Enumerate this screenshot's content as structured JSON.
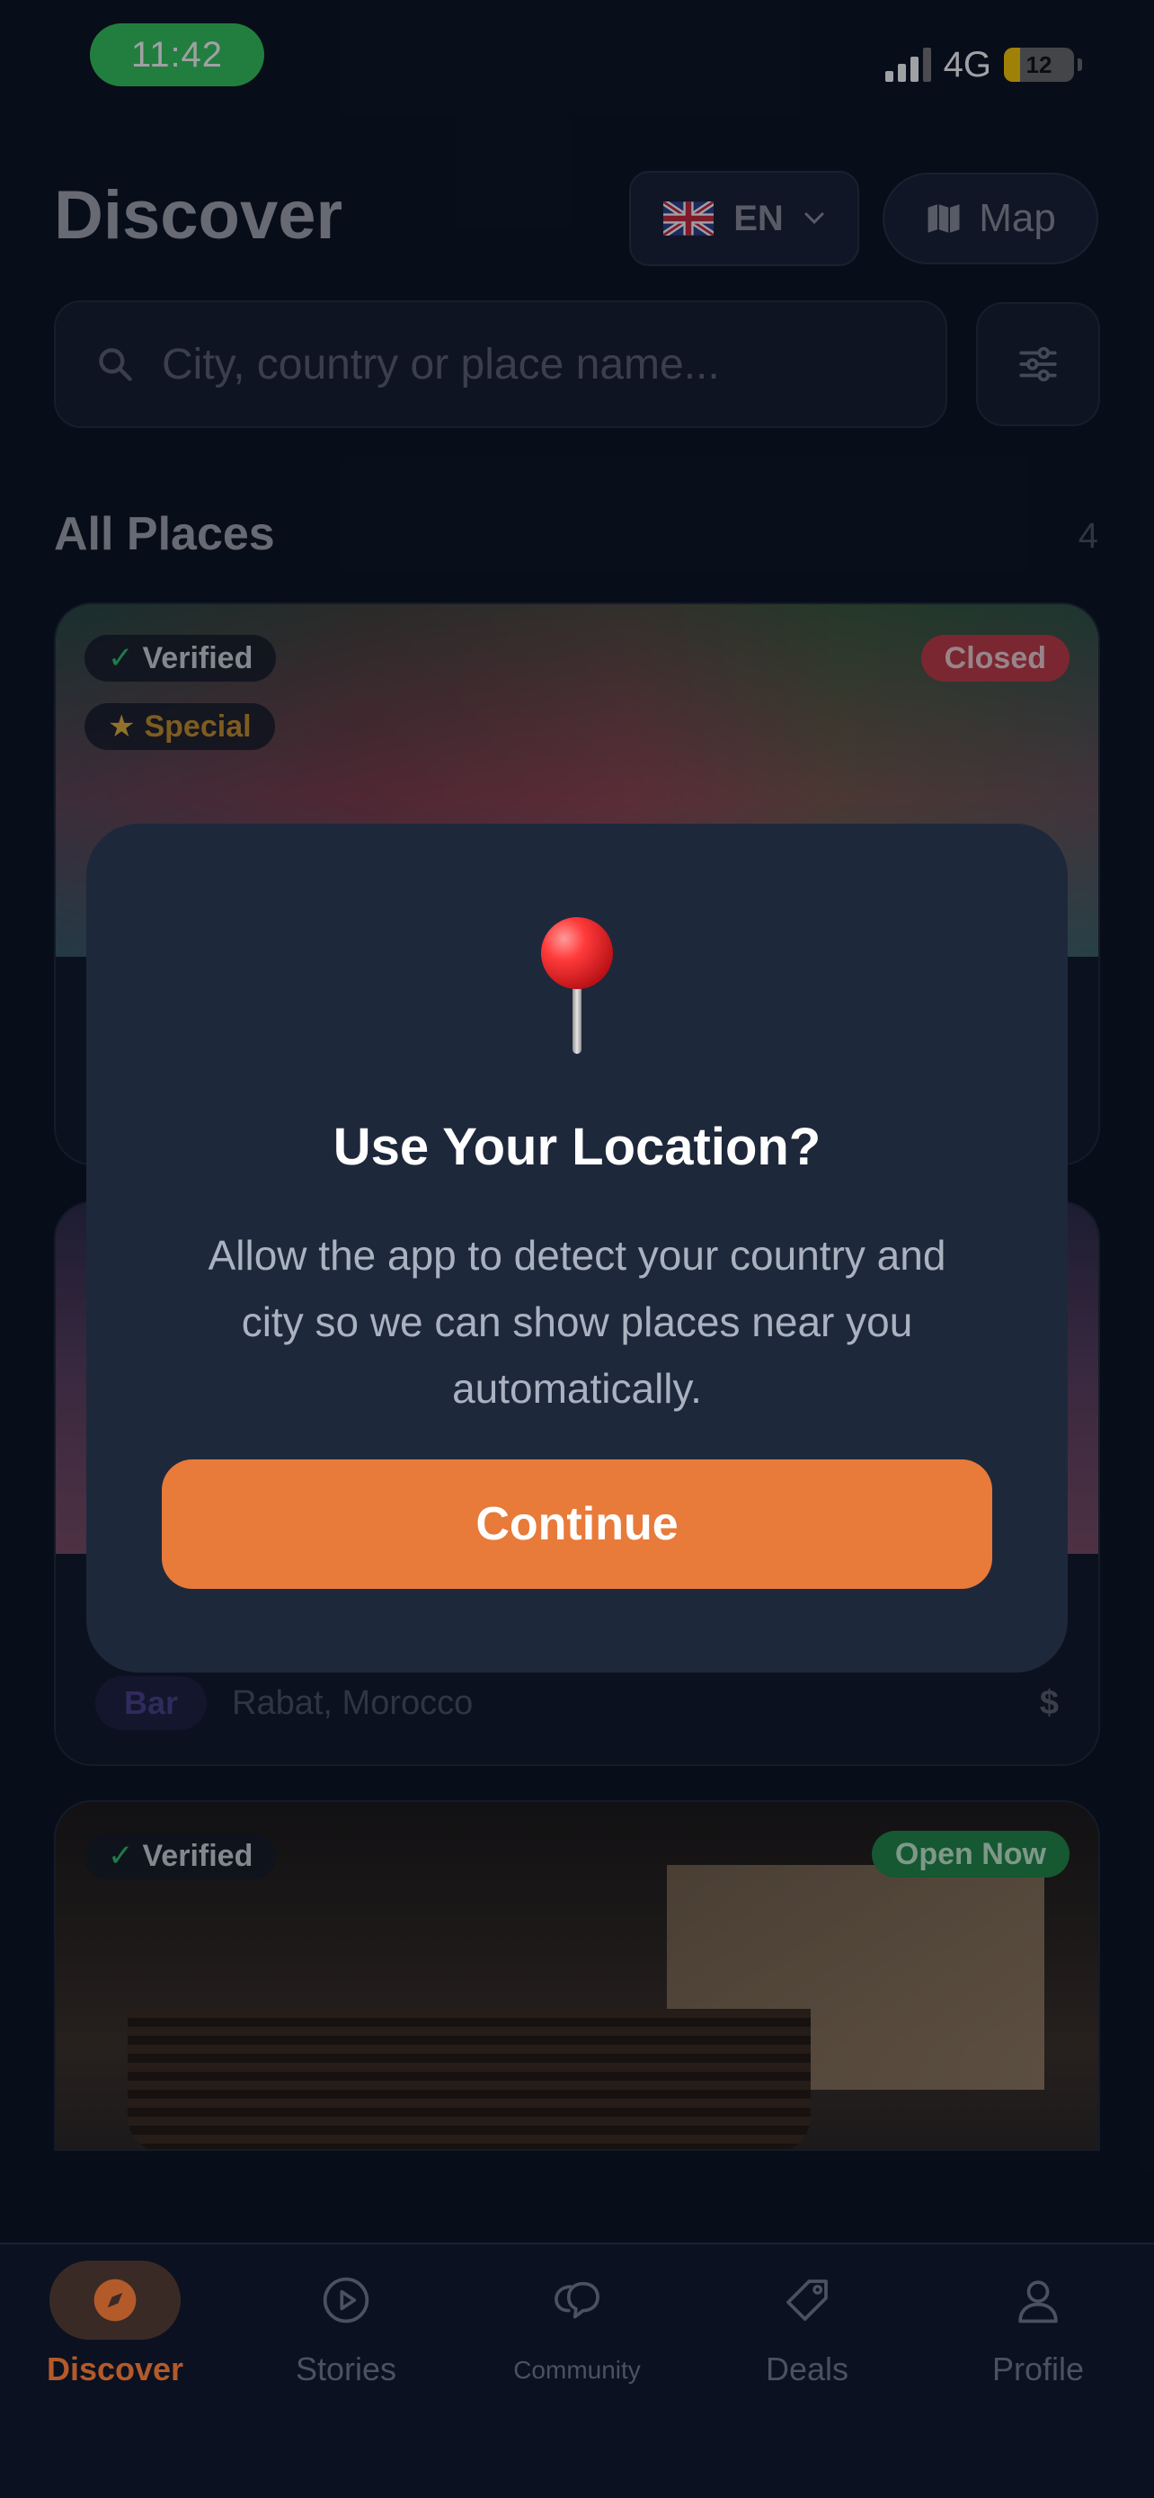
{
  "status_bar": {
    "time": "11:42",
    "network": "4G",
    "battery": "12"
  },
  "header": {
    "title": "Discover",
    "language": {
      "code": "EN",
      "flag_icon": "uk-flag-icon"
    },
    "map_label": "Map"
  },
  "search": {
    "placeholder": "City, country or place name..."
  },
  "section": {
    "title": "All Places",
    "count": "4"
  },
  "cards": [
    {
      "verified_label": "Verified",
      "special_label": "Special",
      "status": "Closed"
    },
    {
      "tag": "Bar",
      "location": "Rabat, Morocco",
      "price": "$"
    },
    {
      "verified_label": "Verified",
      "status": "Open Now"
    }
  ],
  "modal": {
    "title": "Use Your Location?",
    "body": "Allow the app to detect your country and city so we can show places near you automatically.",
    "button": "Continue",
    "icon": "pushpin-icon"
  },
  "tabs": [
    {
      "label": "Discover",
      "icon": "compass-icon",
      "active": true
    },
    {
      "label": "Stories",
      "icon": "play-circle-icon"
    },
    {
      "label": "Community",
      "icon": "chat-bubbles-icon"
    },
    {
      "label": "Deals",
      "icon": "tag-icon"
    },
    {
      "label": "Profile",
      "icon": "user-icon"
    }
  ],
  "colors": {
    "accent": "#e87a3a",
    "closed": "#c23a44",
    "open": "#1f8a45",
    "time_pill": "#34c759"
  }
}
